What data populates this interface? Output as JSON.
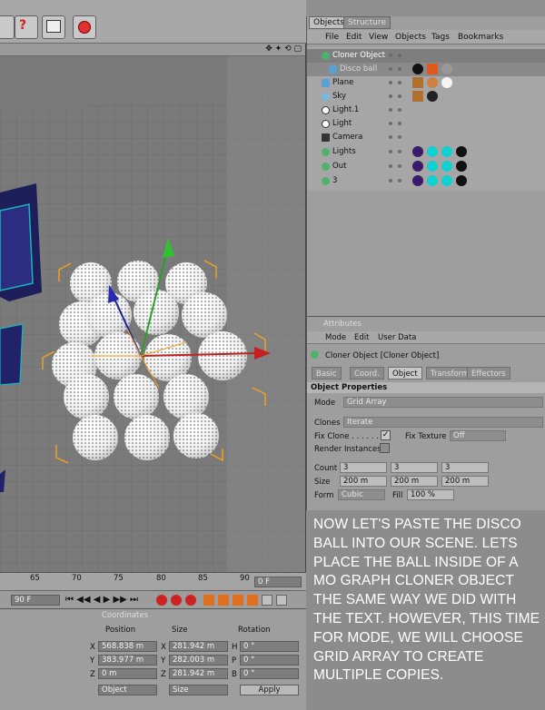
{
  "objects_panel": {
    "tabs": [
      "Objects",
      "Structure"
    ],
    "menu": [
      "File",
      "Edit",
      "View",
      "Objects",
      "Tags",
      "Bookmarks"
    ],
    "rows": [
      {
        "label": "Cloner Object",
        "selected": true
      },
      {
        "label": "Disco ball"
      },
      {
        "label": "Plane"
      },
      {
        "label": "Sky"
      },
      {
        "label": "Light.1"
      },
      {
        "label": "Light"
      },
      {
        "label": "Camera"
      },
      {
        "label": "Lights"
      },
      {
        "label": "Out"
      },
      {
        "label": "3"
      }
    ]
  },
  "attributes_panel": {
    "title": "Attributes",
    "menu": [
      "Mode",
      "Edit",
      "User Data"
    ],
    "object_name": "Cloner Object [Cloner Object]",
    "tabs": [
      "Basic",
      "Coord.",
      "Object",
      "Transform",
      "Effectors"
    ],
    "section": "Object Properties",
    "mode_label": "Mode",
    "mode_value": "Grid Array",
    "clones_label": "Clones",
    "clones_value": "Iterate",
    "fix_clone_label": "Fix Clone . . . . . .",
    "fix_texture_label": "Fix Texture",
    "fix_texture_value": "Off",
    "render_instances_label": "Render Instances",
    "count_label": "Count",
    "count": [
      "3",
      "3",
      "3"
    ],
    "size_label": "Size",
    "size": [
      "200 m",
      "200 m",
      "200 m"
    ],
    "form_label": "Form",
    "form_value": "Cubic",
    "fill_label": "Fill",
    "fill_value": "100 %"
  },
  "timeline": {
    "ticks": [
      "65",
      "70",
      "75",
      "80",
      "85",
      "90"
    ],
    "current_frame": "0 F",
    "end_frame": "90 F"
  },
  "coordinates": {
    "title": "Coordinates",
    "headers": [
      "Position",
      "Size",
      "Rotation"
    ],
    "rows": [
      {
        "axis": "X",
        "pos": "568.838 m",
        "size_axis": "X",
        "size": "281.942 m",
        "rot_axis": "H",
        "rot": "0 °"
      },
      {
        "axis": "Y",
        "pos": "383.977 m",
        "size_axis": "Y",
        "size": "282.003 m",
        "rot_axis": "P",
        "rot": "0 °"
      },
      {
        "axis": "Z",
        "pos": "0 m",
        "size_axis": "Z",
        "size": "281.942 m",
        "rot_axis": "B",
        "rot": "0 °"
      }
    ],
    "mode_dropdown": "Object",
    "size_dropdown": "Size",
    "apply_label": "Apply"
  },
  "instruction_text": "NOW LET'S PASTE THE DISCO BALL INTO OUR SCENE. LETS PLACE THE BALL INSIDE OF A MO GRAPH CLONER OBJECT THE SAME WAY WE DID WITH THE TEXT. HOWEVER, THIS TIME FOR MODE, WE WILL CHOOSE GRID ARRAY TO CREATE MULTIPLE COPIES."
}
